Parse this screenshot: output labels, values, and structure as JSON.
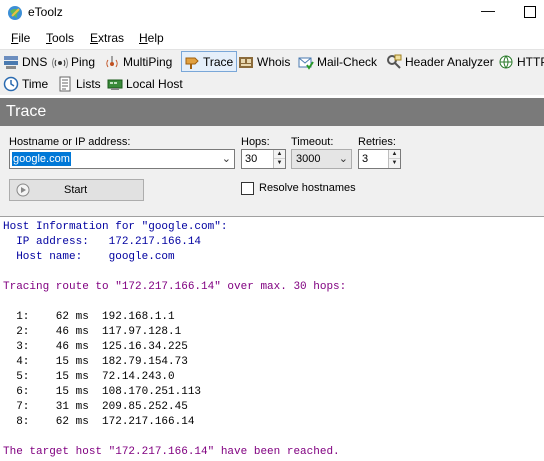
{
  "window": {
    "title": "eToolz",
    "minimize_glyph": "—"
  },
  "menu": [
    "File",
    "Tools",
    "Extras",
    "Help"
  ],
  "toolbar_row1": [
    {
      "label": "DNS",
      "icon": "dns-icon"
    },
    {
      "label": "Ping",
      "icon": "ping-icon"
    },
    {
      "label": "MultiPing",
      "icon": "multiping-icon"
    },
    {
      "label": "Trace",
      "icon": "trace-icon",
      "active": true
    },
    {
      "label": "Whois",
      "icon": "whois-icon"
    },
    {
      "label": "Mail-Check",
      "icon": "mail-check-icon"
    },
    {
      "label": "Header Analyzer",
      "icon": "header-analyzer-icon"
    },
    {
      "label": "HTTP",
      "icon": "http-icon"
    }
  ],
  "toolbar_row2": [
    {
      "label": "Time",
      "icon": "clock-icon"
    },
    {
      "label": "Lists",
      "icon": "lists-icon"
    },
    {
      "label": "Local Host",
      "icon": "local-host-icon"
    }
  ],
  "section_title": "Trace",
  "form": {
    "hostname_label": "Hostname or IP address:",
    "hostname_value": "google.com",
    "hops_label": "Hops:",
    "hops_value": "30",
    "timeout_label": "Timeout:",
    "timeout_value": "3000",
    "retries_label": "Retries:",
    "retries_value": "3",
    "start_label": "Start",
    "resolve_label": "Resolve hostnames",
    "resolve_checked": false
  },
  "output": {
    "host_info_header": "Host Information for \"google.com\":",
    "ip_line": "  IP address:   172.217.166.14",
    "host_line": "  Host name:    google.com",
    "tracing_line": "Tracing route to \"172.217.166.14\" over max. 30 hops:",
    "hops": [
      "  1:    62 ms  192.168.1.1",
      "  2:    46 ms  117.97.128.1",
      "  3:    46 ms  125.16.34.225",
      "  4:    15 ms  182.79.154.73",
      "  5:    15 ms  72.14.243.0",
      "  6:    15 ms  108.170.251.113",
      "  7:    31 ms  209.85.252.45",
      "  8:    62 ms  172.217.166.14"
    ],
    "result_line": "The target host \"172.217.166.14\" have been reached."
  },
  "colors": {
    "header_bg": "#7a7a7a",
    "info_text": "#0000a0",
    "trace_text": "#800080",
    "selection": "#0078d7"
  }
}
